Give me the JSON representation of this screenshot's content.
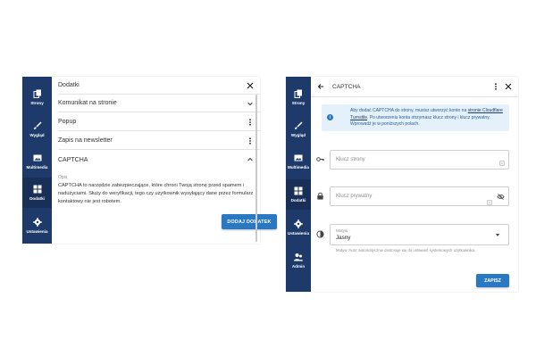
{
  "panel1": {
    "sidebar": [
      {
        "label": "Strony",
        "icon": "copy-icon",
        "active": false
      },
      {
        "label": "Wygląd",
        "icon": "brush-icon",
        "active": false
      },
      {
        "label": "Multimedia",
        "icon": "image-icon",
        "active": false
      },
      {
        "label": "Dodatki",
        "icon": "grid-icon",
        "active": true
      },
      {
        "label": "Ustawienia",
        "icon": "gear-icon",
        "active": false
      }
    ],
    "header_title": "Dodatki",
    "rows": [
      {
        "label": "Komunikat na stronie",
        "icon": "chevron-down-icon"
      },
      {
        "label": "Popup",
        "icon": "more-vertical-icon"
      },
      {
        "label": "Zapis na newsletter",
        "icon": "more-vertical-icon"
      },
      {
        "label": "CAPTCHA",
        "icon": "chevron-up-icon"
      }
    ],
    "description_label": "Opis",
    "description_text": "CAPTCHA to narzędzie zabezpieczające, które chroni Twoją stronę przed spamem i nadużyciami. Służy do weryfikacji, tego czy użytkownik wysyłający dane przez formularz kontaktowy nie jest robotem.",
    "add_button": "DODAJ DODATEK"
  },
  "panel2": {
    "sidebar": [
      {
        "label": "Strony",
        "icon": "copy-icon",
        "active": false
      },
      {
        "label": "Wygląd",
        "icon": "brush-icon",
        "active": false
      },
      {
        "label": "Multimedia",
        "icon": "image-icon",
        "active": false
      },
      {
        "label": "Dodatki",
        "icon": "grid-icon",
        "active": true
      },
      {
        "label": "Ustawienia",
        "icon": "gear-icon",
        "active": false
      },
      {
        "label": "Admin",
        "icon": "users-icon",
        "active": false
      }
    ],
    "title": "CAPTCHA",
    "info": {
      "text_before": "Aby dodać CAPTCHA do strony, musisz utworzyć konto na ",
      "link": "stronie Cloudflare Turnstile",
      "text_after": ". Po utworzeniu konta otrzymasz klucz strony i klucz prywatny. Wprowadź je w poniższych polach."
    },
    "site_key_placeholder": "Klucz strony",
    "private_key_placeholder": "Klucz prywatny",
    "theme_label": "Motyw",
    "theme_value": "Jasny",
    "theme_hint": "Motyw 'Auto' automatycznie dostosuje się do ustawień systemowych użytkownika.",
    "save_button": "ZAPISZ",
    "colors": {
      "sidebar": "#1e3a6b",
      "accent": "#2b78c2",
      "info_bg": "#e4f1fb"
    }
  }
}
